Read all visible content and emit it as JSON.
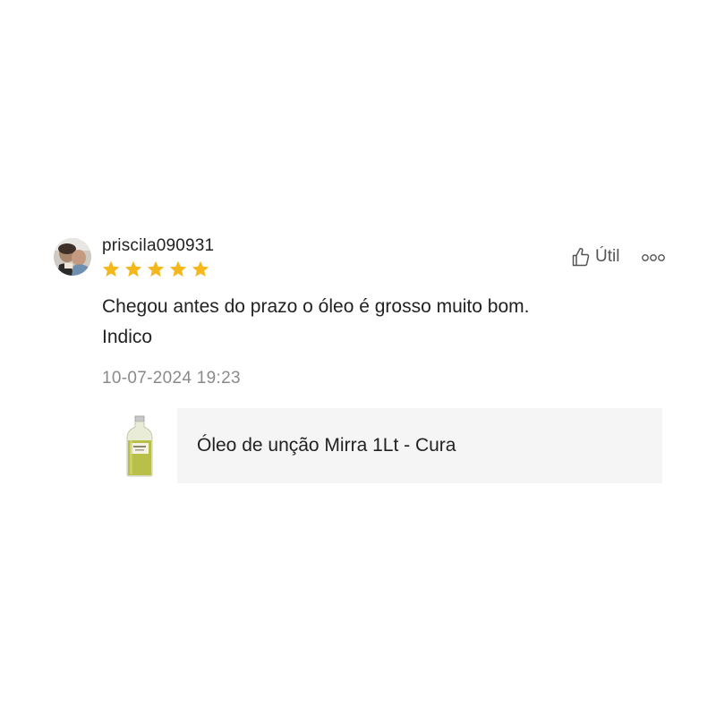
{
  "review": {
    "username": "priscila090931",
    "rating": 5,
    "rating_max": 5,
    "comment_lines": [
      "Chegou antes do prazo o óleo é grosso muito bom.",
      "Indico"
    ],
    "timestamp": "10-07-2024 19:23",
    "helpful_label": "Útil",
    "icons": {
      "avatar": "avatar",
      "star": "star-icon",
      "helpful": "thumbs-up-icon",
      "more": "more-options-icon"
    },
    "colors": {
      "star": "#F5B81C",
      "text": "#222222",
      "timestamp": "#8A8A8A",
      "card_background": "#F5F5F5"
    }
  },
  "product": {
    "title": "Óleo de unção Mirra 1Lt - Cura"
  }
}
